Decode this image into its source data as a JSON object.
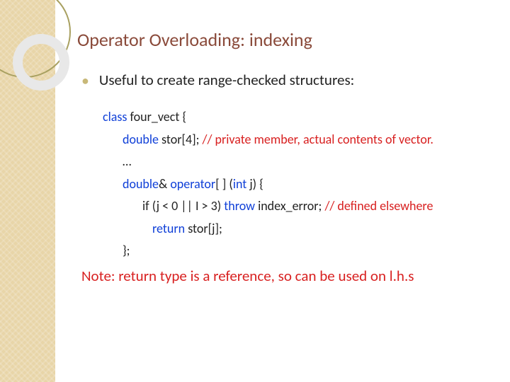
{
  "title": "Operator Overloading: indexing",
  "bullet_text": "Useful to create range-checked structures:",
  "code": {
    "l1_kw": "class",
    "l1_rest": " four_vect {",
    "l2_kw": "double",
    "l2_rest": " stor[4];       ",
    "l2_cm": "//  private member, actual contents of vector.",
    "l3": "…",
    "l4_kw1": "double",
    "l4_mid1": "& ",
    "l4_kw2": "operator",
    "l4_mid2": "[ ] (",
    "l4_kw3": "int",
    "l4_rest": " j) {",
    "l5_a": "if (j < 0 || I > 3) ",
    "l5_kw": "throw",
    "l5_b": " index_error;  ",
    "l5_cm": "// defined elsewhere",
    "l6_kw": "return",
    "l6_rest": " stor[j];",
    "l7": "};"
  },
  "note": "Note: return type is a reference, so can be used on l.h.s"
}
